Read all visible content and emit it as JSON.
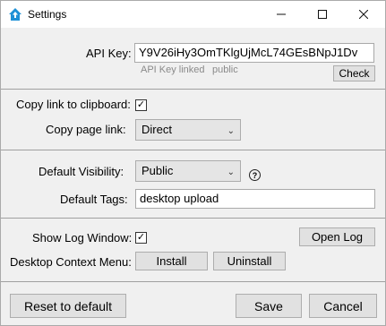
{
  "window": {
    "title": "Settings",
    "icons": {
      "app": "home-upload-icon",
      "minimize": "minimize-icon",
      "maximize": "maximize-icon",
      "close": "close-icon"
    }
  },
  "api": {
    "label": "API Key:",
    "value": "Y9V26iHy3OmTKlgUjMcL74GEsBNpJ1Dv",
    "status_linked": "API Key linked",
    "status_public": "public",
    "check_label": "Check"
  },
  "link": {
    "copy_label": "Copy link to clipboard:",
    "copy_checked": true,
    "page_link_label": "Copy page link:",
    "page_link_value": "Direct"
  },
  "defaults": {
    "visibility_label": "Default Visibility:",
    "visibility_value": "Public",
    "help_glyph": "?",
    "tags_label": "Default Tags:",
    "tags_value": "desktop upload"
  },
  "log": {
    "show_label": "Show Log Window:",
    "show_checked": true,
    "open_log_label": "Open Log",
    "context_menu_label": "Desktop Context Menu:",
    "install_label": "Install",
    "uninstall_label": "Uninstall"
  },
  "footer": {
    "reset_label": "Reset to default",
    "save_label": "Save",
    "cancel_label": "Cancel"
  }
}
